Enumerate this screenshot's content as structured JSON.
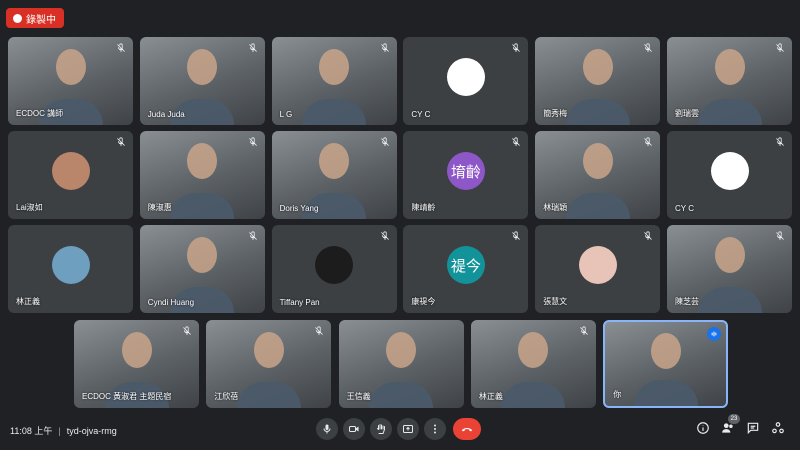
{
  "recording": {
    "label": "錄製中",
    "color": "#d93025"
  },
  "participants": [
    {
      "name": "ECDOC 講師",
      "type": "video",
      "muted": true
    },
    {
      "name": "Juda Juda",
      "type": "video",
      "muted": true
    },
    {
      "name": "L G",
      "type": "video",
      "muted": true
    },
    {
      "name": "CY C",
      "type": "avatar",
      "avatar_text": "",
      "avatar_color": "#ffffff",
      "muted": true
    },
    {
      "name": "簡秀梅",
      "type": "video",
      "muted": true
    },
    {
      "name": "劉瑞雲",
      "type": "video",
      "muted": true
    },
    {
      "name": "Lai淑如",
      "type": "avatar",
      "avatar_text": "",
      "avatar_color": "#b9856b",
      "muted": true
    },
    {
      "name": "陳淑惠",
      "type": "video",
      "muted": true
    },
    {
      "name": "Doris Yang",
      "type": "video",
      "muted": true
    },
    {
      "name": "陳靖齡",
      "type": "avatar",
      "avatar_text": "堉齡",
      "avatar_color": "#8e57c8",
      "muted": true
    },
    {
      "name": "林瑞穎",
      "type": "video",
      "muted": true
    },
    {
      "name": "CY C",
      "type": "avatar",
      "avatar_text": "",
      "avatar_color": "#ffffff",
      "muted": true
    },
    {
      "name": "林正義",
      "type": "avatar",
      "avatar_text": "",
      "avatar_color": "#6f9fbf",
      "muted": false
    },
    {
      "name": "Cyndi Huang",
      "type": "video",
      "muted": true
    },
    {
      "name": "Tiffany Pan",
      "type": "avatar",
      "avatar_text": "",
      "avatar_color": "#1c1c1c",
      "muted": true
    },
    {
      "name": "康禔今",
      "type": "avatar",
      "avatar_text": "禔今",
      "avatar_color": "#12939a",
      "muted": true
    },
    {
      "name": "張慧文",
      "type": "avatar",
      "avatar_text": "",
      "avatar_color": "#e8c4b8",
      "muted": true
    },
    {
      "name": "陳芝芸",
      "type": "video",
      "muted": true
    },
    {
      "name": "ECDOC 黃淑君 主題民宿",
      "type": "video",
      "muted": true
    },
    {
      "name": "江欣蓓",
      "type": "video",
      "muted": true
    },
    {
      "name": "王信義",
      "type": "video",
      "muted": false
    },
    {
      "name": "林正義",
      "type": "video",
      "muted": true
    },
    {
      "name": "你",
      "type": "video",
      "muted": false,
      "speaking": true,
      "active": true
    }
  ],
  "meeting": {
    "time": "11:08 上午",
    "code": "tyd-ojva-rmg"
  },
  "controls": {
    "mic": "mic-icon",
    "camera": "camera-icon",
    "raise_hand": "raise-hand-icon",
    "present": "present-screen-icon",
    "more": "more-options-icon",
    "hangup": "hang-up-icon"
  },
  "right_controls": {
    "info": "info-icon",
    "people": "people-icon",
    "people_count": "23",
    "chat": "chat-icon",
    "activities": "activities-icon"
  },
  "colors": {
    "background": "#202124",
    "tile": "#3c4043",
    "hangup": "#ea4335",
    "accent": "#8ab4f8"
  }
}
